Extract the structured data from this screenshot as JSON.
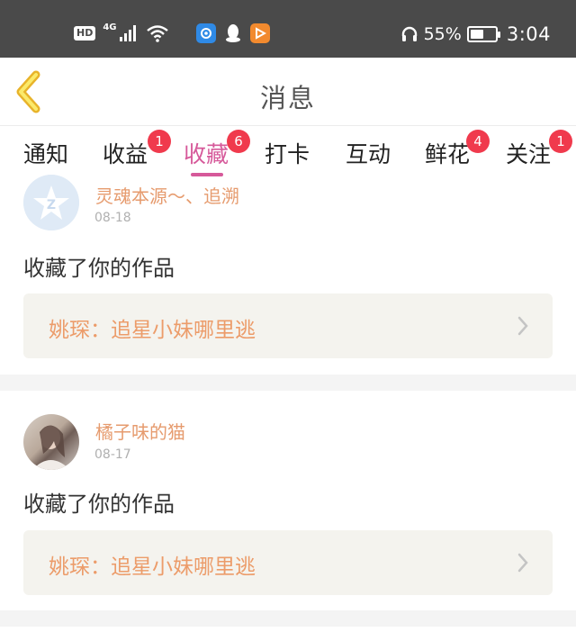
{
  "status_bar": {
    "hd": "HD",
    "network": "4G",
    "battery_percent": "55%",
    "battery_level": 0.55,
    "time": "3:04"
  },
  "header": {
    "title": "消息"
  },
  "tabs": [
    {
      "label": "通知",
      "badge": null
    },
    {
      "label": "收益",
      "badge": "1"
    },
    {
      "label": "收藏",
      "badge": "6",
      "active": true
    },
    {
      "label": "打卡",
      "badge": null
    },
    {
      "label": "互动",
      "badge": null
    },
    {
      "label": "鲜花",
      "badge": "4"
    },
    {
      "label": "关注",
      "badge": "1"
    }
  ],
  "notifications": [
    {
      "username": "灵魂本源～、追溯",
      "date": "08-18",
      "action": "收藏了你的作品",
      "work_title": "姚琛：追星小妹哪里逃"
    },
    {
      "username": "橘子味的猫",
      "date": "08-17",
      "action": "收藏了你的作品",
      "work_title": "姚琛：追星小妹哪里逃"
    }
  ],
  "colors": {
    "status_bar_bg": "#4a4a4a",
    "active_tab": "#d6599a",
    "badge": "#f03a4d",
    "username": "#e69b6e",
    "work_title": "#ec9c6a"
  }
}
